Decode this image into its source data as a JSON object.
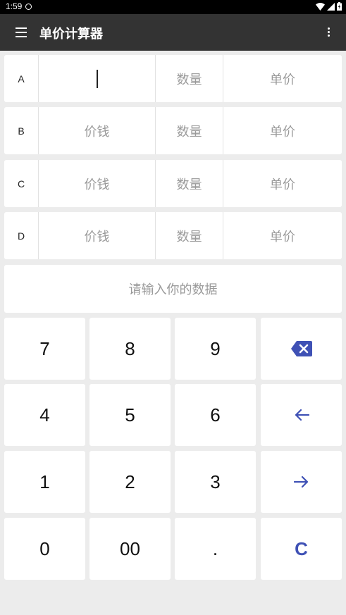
{
  "status": {
    "time": "1:59"
  },
  "app": {
    "title": "单价计算器"
  },
  "rows": [
    {
      "label": "A",
      "price": "",
      "qty": "数量",
      "unit": "单价"
    },
    {
      "label": "B",
      "price": "价钱",
      "qty": "数量",
      "unit": "单价"
    },
    {
      "label": "C",
      "price": "价钱",
      "qty": "数量",
      "unit": "单价"
    },
    {
      "label": "D",
      "price": "价钱",
      "qty": "数量",
      "unit": "单价"
    }
  ],
  "message": "请输入你的数据",
  "keypad": {
    "k7": "7",
    "k8": "8",
    "k9": "9",
    "k4": "4",
    "k5": "5",
    "k6": "6",
    "k1": "1",
    "k2": "2",
    "k3": "3",
    "k0": "0",
    "k00": "00",
    "kdot": ".",
    "kclear": "C"
  },
  "colors": {
    "accent": "#3f51b5",
    "app_bar": "#333333",
    "background": "#ececec"
  }
}
